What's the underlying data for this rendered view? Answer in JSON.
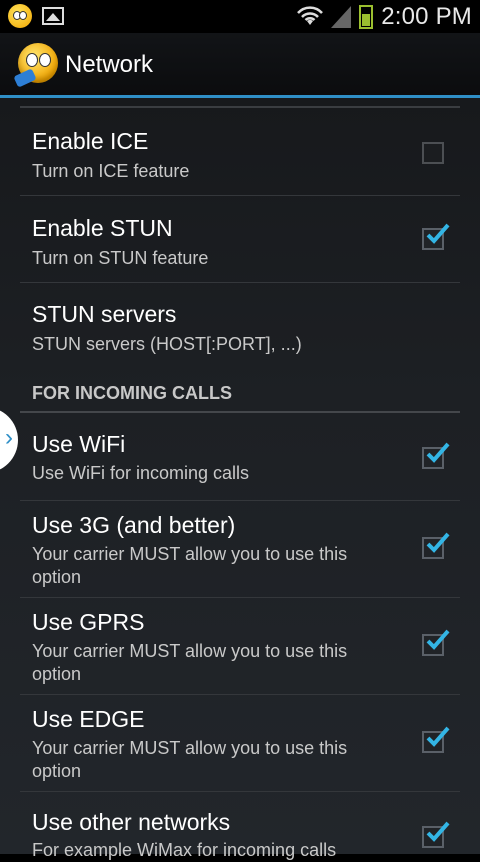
{
  "status_bar": {
    "time": "2:00 PM",
    "icons": [
      "emoji-notification-icon",
      "image-icon",
      "wifi-icon",
      "signal-icon",
      "battery-icon"
    ],
    "battery_color": "#9bbf2f"
  },
  "action_bar": {
    "title": "Network",
    "accent_color": "#2f8fc7"
  },
  "preferences": [
    {
      "title": "Enable ICE",
      "summary": "Turn on ICE feature",
      "checked": false
    },
    {
      "title": "Enable STUN",
      "summary": "Turn on STUN feature",
      "checked": true
    },
    {
      "title": "STUN servers",
      "summary": "STUN servers (HOST[:PORT], ...)",
      "checked": null
    }
  ],
  "section": {
    "header": "FOR INCOMING CALLS"
  },
  "incoming_preferences": [
    {
      "title": "Use WiFi",
      "summary": "Use WiFi for incoming calls",
      "checked": true
    },
    {
      "title": "Use 3G (and better)",
      "summary": "Your carrier MUST allow you to use this option",
      "checked": true
    },
    {
      "title": "Use GPRS",
      "summary": "Your carrier MUST allow you to use this option",
      "checked": true
    },
    {
      "title": "Use EDGE",
      "summary": "Your carrier MUST allow you to use this option",
      "checked": true
    },
    {
      "title": "Use other networks",
      "summary": "For example WiMax for incoming calls",
      "checked": true
    }
  ],
  "side_tab": {
    "glyph": "›"
  }
}
